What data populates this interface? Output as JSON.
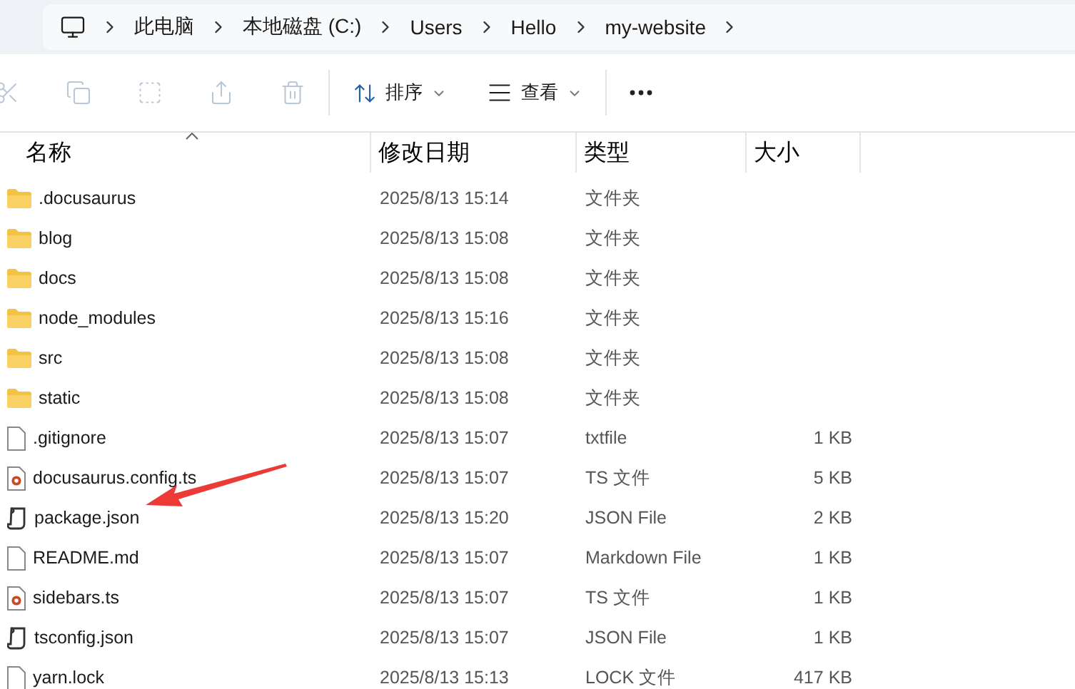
{
  "breadcrumb": [
    "此电脑",
    "本地磁盘 (C:)",
    "Users",
    "Hello",
    "my-website"
  ],
  "toolbar": {
    "actions": [
      {
        "kind": "cut",
        "disabled": true
      },
      {
        "kind": "copy",
        "disabled": true
      },
      {
        "kind": "rename",
        "disabled": true
      },
      {
        "kind": "share",
        "disabled": true
      },
      {
        "kind": "delete",
        "disabled": true
      }
    ],
    "sort": "排序",
    "view": "查看"
  },
  "table": {
    "columns": [
      {
        "label": "名称",
        "sorted": true
      },
      {
        "label": "修改日期",
        "sorted": false
      },
      {
        "label": "类型",
        "sorted": false
      },
      {
        "label": "大小",
        "sorted": false
      }
    ],
    "rows": [
      {
        "kind": "folder",
        "name": ".docusaurus",
        "date": "2025/8/13 15:14",
        "type": "文件夹"
      },
      {
        "kind": "folder",
        "name": "blog",
        "date": "2025/8/13 15:08",
        "type": "文件夹"
      },
      {
        "kind": "folder",
        "name": "docs",
        "date": "2025/8/13 15:08",
        "type": "文件夹"
      },
      {
        "kind": "folder",
        "name": "node_modules",
        "date": "2025/8/13 15:16",
        "type": "文件夹"
      },
      {
        "kind": "folder",
        "name": "src",
        "date": "2025/8/13 15:08",
        "type": "文件夹"
      },
      {
        "kind": "folder",
        "name": "static",
        "date": "2025/8/13 15:08",
        "type": "文件夹"
      },
      {
        "kind": "file",
        "name": ".gitignore",
        "date": "2025/8/13 15:07",
        "type": "txtfile",
        "size": "1 KB"
      },
      {
        "kind": "ts",
        "name": "docusaurus.config.ts",
        "date": "2025/8/13 15:07",
        "type": "TS 文件",
        "size": "5 KB"
      },
      {
        "kind": "json",
        "name": "package.json",
        "date": "2025/8/13 15:20",
        "type": "JSON File",
        "size": "2 KB"
      },
      {
        "kind": "file",
        "name": "README.md",
        "date": "2025/8/13 15:07",
        "type": "Markdown File",
        "size": "1 KB"
      },
      {
        "kind": "ts",
        "name": "sidebars.ts",
        "date": "2025/8/13 15:07",
        "type": "TS 文件",
        "size": "1 KB"
      },
      {
        "kind": "json",
        "name": "tsconfig.json",
        "date": "2025/8/13 15:07",
        "type": "JSON File",
        "size": "1 KB"
      },
      {
        "kind": "file",
        "name": "yarn.lock",
        "date": "2025/8/13 15:13",
        "type": "LOCK 文件",
        "size": "417 KB"
      }
    ]
  }
}
